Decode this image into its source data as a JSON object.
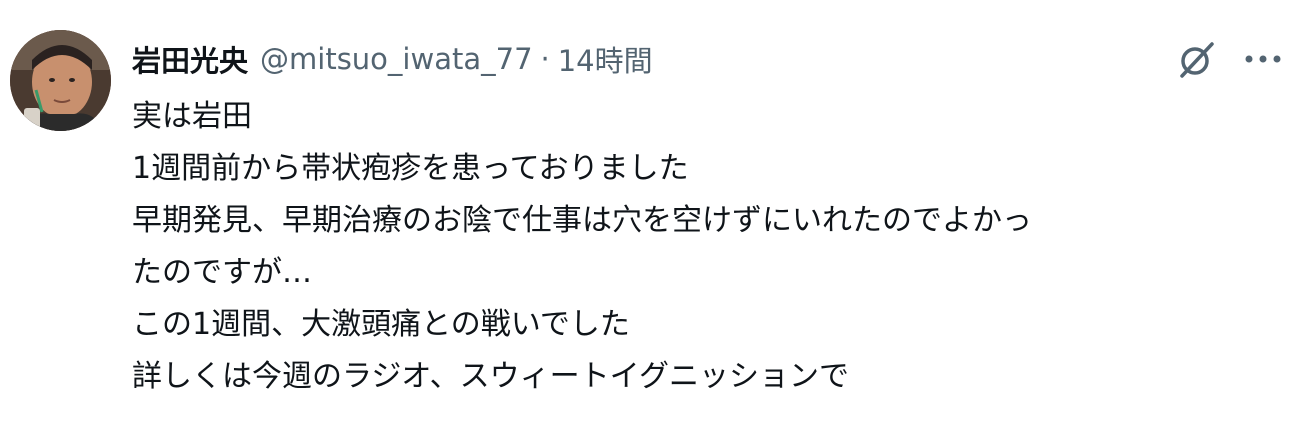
{
  "tweet": {
    "display_name": "岩田光央",
    "handle": "@mitsuo_iwata_77",
    "separator": "·",
    "time": "14時間",
    "avatar_icon": "user-avatar",
    "grok_icon": "grok-icon",
    "more_icon": "more-options-icon",
    "lines": [
      "実は岩田",
      "1週間前から帯状疱疹を患っておりました",
      "早期発見、早期治療のお陰で仕事は穴を空けずにいれたのでよかっ",
      "たのですが…",
      "この1週間、大激頭痛との戦いでした",
      "詳しくは今週のラジオ、スウィートイグニッションで"
    ]
  },
  "colors": {
    "text_primary": "#0f1419",
    "text_secondary": "#536471"
  }
}
